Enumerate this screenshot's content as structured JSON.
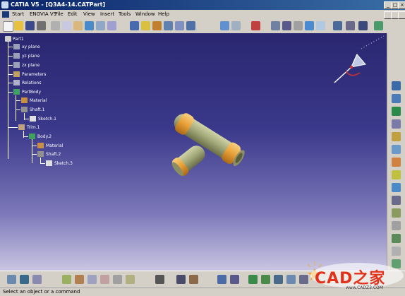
{
  "window": {
    "title": "CATIA V5 - [Q3A4-14.CATPart]",
    "minimize": "_",
    "maximize": "□",
    "close": "×"
  },
  "menu": {
    "items": [
      "Start",
      "ENOVIA V5",
      "File",
      "Edit",
      "View",
      "Insert",
      "Tools",
      "Window",
      "Help"
    ]
  },
  "tree": {
    "root": "Part1",
    "planes": [
      "xy plane",
      "yz plane",
      "zx plane"
    ],
    "parameters": "Parameters",
    "relations": "Relations",
    "partbody": "PartBody",
    "partbody_children": [
      "Material",
      "Shaft.1",
      "Sketch.1"
    ],
    "trim": "Trim.1",
    "body2": "Body.2",
    "body2_children": [
      "Material",
      "Shaft.2",
      "Sketch.3"
    ]
  },
  "status": {
    "message": "Select an object or a command"
  },
  "watermark": {
    "text": "CAD之家",
    "url": "www.CADZ3.COM"
  },
  "icons": {
    "top_toolbar": [
      "new-icon",
      "open-icon",
      "save-icon",
      "print-icon",
      "cut-icon",
      "copy-icon",
      "paste-icon",
      "undo-icon",
      "redo-icon",
      "whats-this-icon",
      "view-cube-icon",
      "view-iso-icon",
      "view-shading-icon",
      "view-hide-icon",
      "view-swap-icon",
      "view-normal-icon",
      "sketcher-icon",
      "sketch-constraint-icon",
      "extrude-icon",
      "measure-icon",
      "axis-icon",
      "angle-icon",
      "material-icon",
      "catalog-icon",
      "grid-icon",
      "snap-icon"
    ],
    "right_toolbar": [
      "pad-icon",
      "pocket-icon",
      "shaft-icon",
      "groove-icon",
      "hole-icon",
      "rib-icon",
      "slot-icon",
      "fillet-icon",
      "chamfer-icon",
      "draft-icon",
      "shell-icon",
      "mirror-icon",
      "pattern-icon",
      "split-icon",
      "analysis-icon"
    ],
    "bottom_toolbar": [
      "align-icon",
      "constraint-icon",
      "dress-icon",
      "boolean-icon",
      "transform-icon",
      "pattern-bottom-icon",
      "formula-icon",
      "table-icon",
      "parameter-icon",
      "law-icon",
      "design-table-icon",
      "measure-bottom-icon",
      "fly-icon",
      "rotate-icon",
      "pan-icon",
      "zoom-icon",
      "fit-all-icon",
      "normal-view-icon",
      "multi-view-icon",
      "shading-icon"
    ]
  },
  "colors": {
    "viewport_top": "#2a2770",
    "viewport_bottom": "#c9c5e2",
    "part_body": "#a3a87a",
    "part_ring": "#e8a038",
    "brand_red": "#e2321c"
  }
}
